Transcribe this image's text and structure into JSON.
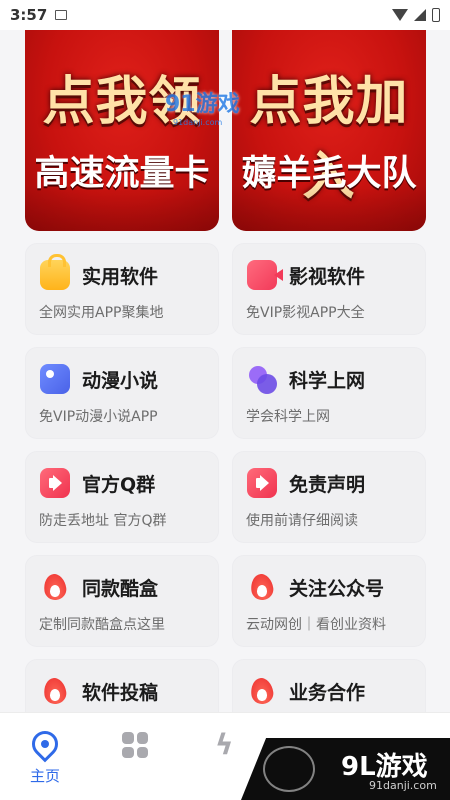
{
  "status_bar": {
    "time": "3:57"
  },
  "banners": [
    {
      "line1": "点我领",
      "line2": "高速流量卡"
    },
    {
      "line1": "点我加入",
      "line2": "薅羊毛大队"
    }
  ],
  "watermark": {
    "logo": "91游戏",
    "url": "91danji.com"
  },
  "cards": [
    {
      "title": "实用软件",
      "subtitle": "全网实用APP聚集地",
      "icon": "shopping-bag-icon"
    },
    {
      "title": "影视软件",
      "subtitle": "免VIP影视APP大全",
      "icon": "video-camera-icon"
    },
    {
      "title": "动漫小说",
      "subtitle": "免VIP动漫小说APP",
      "icon": "image-book-icon"
    },
    {
      "title": "科学上网",
      "subtitle": "学会科学上网",
      "icon": "overlapping-circles-icon"
    },
    {
      "title": "官方Q群",
      "subtitle": "防走丢地址 官方Q群",
      "icon": "megaphone-icon"
    },
    {
      "title": "免责声明",
      "subtitle": "使用前请仔细阅读",
      "icon": "megaphone-icon"
    },
    {
      "title": "同款酷盒",
      "subtitle": "定制同款酷盒点这里",
      "icon": "flame-icon"
    },
    {
      "title": "关注公众号",
      "subtitle": "云动网创｜看创业资料",
      "icon": "flame-icon"
    },
    {
      "title": "软件投稿",
      "subtitle": "",
      "icon": "flame-icon"
    },
    {
      "title": "业务合作",
      "subtitle": "",
      "icon": "flame-icon"
    }
  ],
  "bottom_nav": {
    "home_label": "主页"
  },
  "logo_overlay": {
    "main": "9L游戏",
    "url": "91danji.com"
  },
  "colors": {
    "accent": "#2f6ae8",
    "banner_red": "#c8120f",
    "card_bg": "#f0f0f2"
  }
}
